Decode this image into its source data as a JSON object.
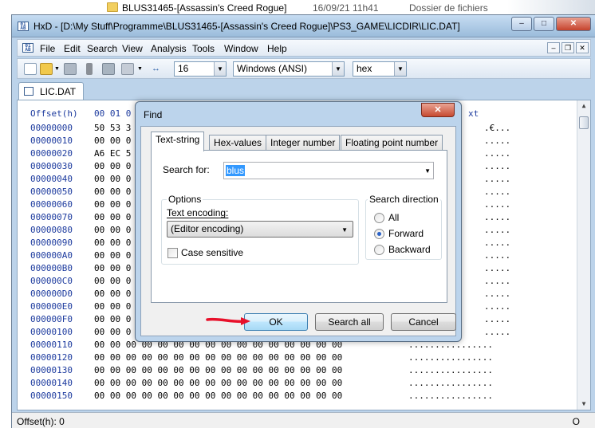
{
  "explorer_row": {
    "name": "BLUS31465-[Assassin's Creed Rogue]",
    "date": "16/09/21 11h41",
    "type": "Dossier de fichiers"
  },
  "window": {
    "app_icon": "hxd-icon",
    "title": "HxD - [D:\\My Stuff\\Programme\\BLUS31465-[Assassin's Creed Rogue]\\PS3_GAME\\LICDIR\\LIC.DAT]"
  },
  "menu": [
    "File",
    "Edit",
    "Search",
    "View",
    "Analysis",
    "Tools",
    "Window",
    "Help"
  ],
  "toolbar": {
    "bytes_per_row": "16",
    "charset": "Windows (ANSI)",
    "offset_base": "hex"
  },
  "tab": {
    "label": "LIC.DAT"
  },
  "editor": {
    "header_offset": "Offset(h)",
    "header_cols": "00 01 0",
    "header_text": "xt",
    "rows": [
      {
        "offset": "00000000",
        "hex": "50 53 3",
        "text": ".€..."
      },
      {
        "offset": "00000010",
        "hex": "00 00 0",
        "text": "....."
      },
      {
        "offset": "00000020",
        "hex": "A6 EC 5",
        "text": "....."
      },
      {
        "offset": "00000030",
        "hex": "00 00 0",
        "text": "....."
      },
      {
        "offset": "00000040",
        "hex": "00 00 0",
        "text": "....."
      },
      {
        "offset": "00000050",
        "hex": "00 00 0",
        "text": "....."
      },
      {
        "offset": "00000060",
        "hex": "00 00 0",
        "text": "....."
      },
      {
        "offset": "00000070",
        "hex": "00 00 0",
        "text": "....."
      },
      {
        "offset": "00000080",
        "hex": "00 00 0",
        "text": "....."
      },
      {
        "offset": "00000090",
        "hex": "00 00 0",
        "text": "....."
      },
      {
        "offset": "000000A0",
        "hex": "00 00 0",
        "text": "....."
      },
      {
        "offset": "000000B0",
        "hex": "00 00 0",
        "text": "....."
      },
      {
        "offset": "000000C0",
        "hex": "00 00 0",
        "text": "....."
      },
      {
        "offset": "000000D0",
        "hex": "00 00 0",
        "text": "....."
      },
      {
        "offset": "000000E0",
        "hex": "00 00 0",
        "text": "....."
      },
      {
        "offset": "000000F0",
        "hex": "00 00 0",
        "text": "....."
      },
      {
        "offset": "00000100",
        "hex": "00 00 0",
        "text": "....."
      },
      {
        "offset": "00000110",
        "hex": "00 00 00 00 00 00 00 00 00 00 00 00 00 00 00 00",
        "text": "................"
      },
      {
        "offset": "00000120",
        "hex": "00 00 00 00 00 00 00 00 00 00 00 00 00 00 00 00",
        "text": "................"
      },
      {
        "offset": "00000130",
        "hex": "00 00 00 00 00 00 00 00 00 00 00 00 00 00 00 00",
        "text": "................"
      },
      {
        "offset": "00000140",
        "hex": "00 00 00 00 00 00 00 00 00 00 00 00 00 00 00 00",
        "text": "................"
      },
      {
        "offset": "00000150",
        "hex": "00 00 00 00 00 00 00 00 00 00 00 00 00 00 00 00",
        "text": "................"
      }
    ]
  },
  "status": {
    "offset": "Offset(h): 0",
    "right": "O"
  },
  "find_dialog": {
    "title": "Find",
    "close": "x",
    "tabs": [
      "Text-string",
      "Hex-values",
      "Integer number",
      "Floating point number"
    ],
    "search_for_label": "Search for:",
    "search_value": "blus",
    "options_label": "Options",
    "text_encoding_label": "Text encoding:",
    "text_encoding_value": "(Editor encoding)",
    "case_sensitive_label": "Case sensitive",
    "direction_label": "Search direction",
    "directions": [
      "All",
      "Forward",
      "Backward"
    ],
    "selected_direction": "Forward",
    "buttons": {
      "ok": "OK",
      "search_all": "Search all",
      "cancel": "Cancel"
    }
  },
  "colors": {
    "offset_blue": "#1c3a9e",
    "annotation_arrow": "#e8102a",
    "selection": "#3399ff"
  }
}
